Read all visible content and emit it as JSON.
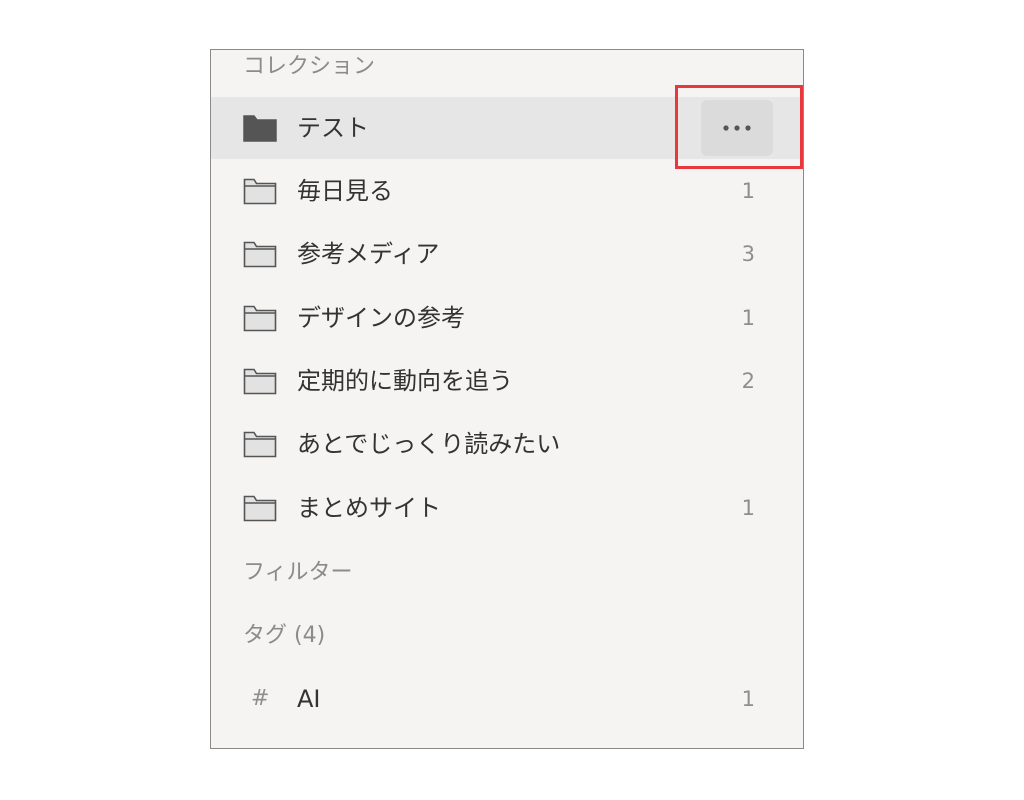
{
  "sections": {
    "collections_header": "コレクション",
    "filters_header": "フィルター",
    "tags_header": "タグ (4)"
  },
  "collections": [
    {
      "label": "テスト",
      "count": "",
      "selected": true,
      "icon": "folder-filled-icon"
    },
    {
      "label": "毎日見る",
      "count": "1",
      "selected": false,
      "icon": "folder-outline-icon"
    },
    {
      "label": "参考メディア",
      "count": "3",
      "selected": false,
      "icon": "folder-outline-icon"
    },
    {
      "label": "デザインの参考",
      "count": "1",
      "selected": false,
      "icon": "folder-outline-icon"
    },
    {
      "label": "定期的に動向を追う",
      "count": "2",
      "selected": false,
      "icon": "folder-outline-icon"
    },
    {
      "label": "あとでじっくり読みたい",
      "count": "",
      "selected": false,
      "icon": "folder-outline-icon"
    },
    {
      "label": "まとめサイト",
      "count": "1",
      "selected": false,
      "icon": "folder-outline-icon"
    }
  ],
  "more_button": {
    "icon": "more-horizontal-icon"
  },
  "tags": [
    {
      "hash": "#",
      "label": "AI",
      "count": "1"
    }
  ],
  "colors": {
    "panel_bg": "#f5f4f3",
    "selected_row": "#e6e6e6",
    "highlight": "#e8373d",
    "text": "#333333",
    "muted": "#8b8b8b"
  }
}
